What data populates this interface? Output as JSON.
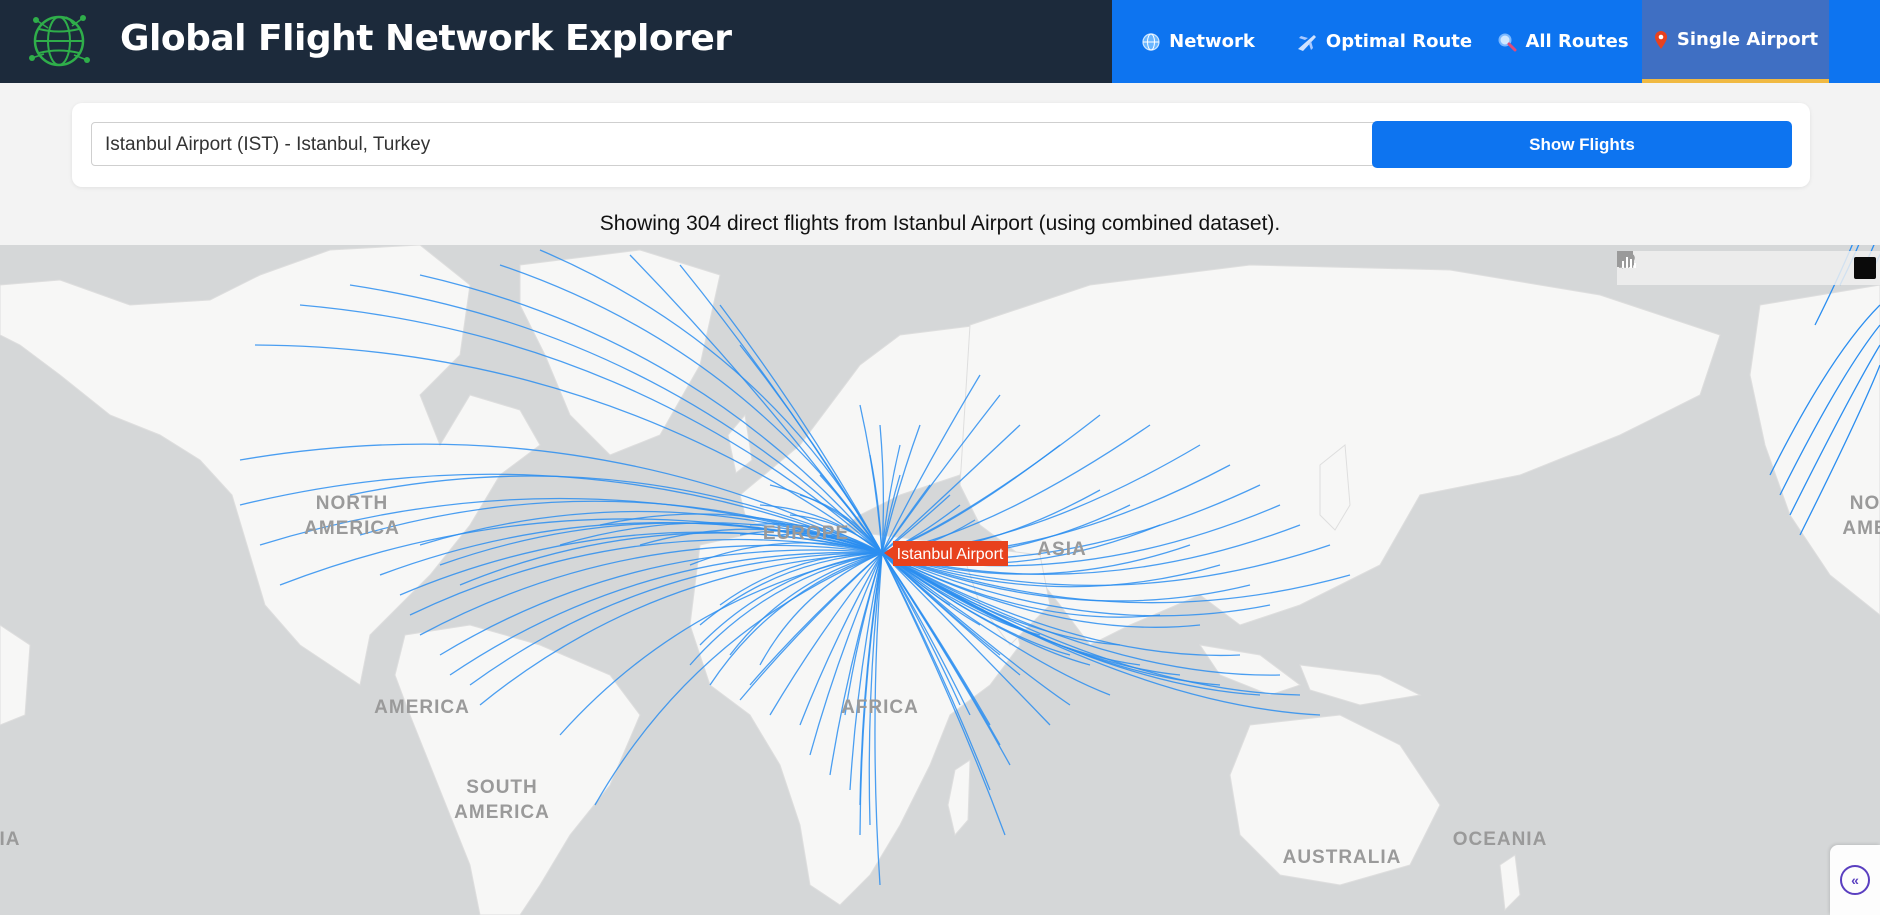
{
  "app": {
    "title": "Global Flight Network Explorer",
    "logo_icon": "globe-network-icon"
  },
  "tabs": [
    {
      "label": "Network",
      "icon": "globe-icon",
      "active": false
    },
    {
      "label": "Optimal Route",
      "icon": "airplane-icon",
      "active": false
    },
    {
      "label": "All Routes",
      "icon": "magnifier-icon",
      "active": false
    },
    {
      "label": "Single Airport",
      "icon": "pin-icon",
      "active": true
    }
  ],
  "controls": {
    "airport_select_value": "Istanbul Airport (IST) - Istanbul, Turkey",
    "clear_symbol": "×",
    "show_button_label": "Show Flights"
  },
  "status_text": "Showing 304 direct flights from Istanbul Airport (using combined dataset).",
  "map": {
    "hub_label": "Istanbul Airport",
    "route_color": "#2b8ef0",
    "hub_label_color": "#e8421e",
    "labels": {
      "north_america": [
        "NORTH",
        "AMERICA"
      ],
      "south_america": [
        "SOUTH",
        "AMERICA"
      ],
      "america": "AMERICA",
      "europe": "EUROPE",
      "asia": "ASIA",
      "africa": "AFRICA",
      "australia": "AUSTRALIA",
      "oceania": "OCEANIA",
      "cut_left": "IA",
      "cut_right": [
        "NO",
        "AME"
      ]
    },
    "modebar_icons": [
      "camera-icon",
      "pan-icon",
      "box-select-icon",
      "lasso-icon",
      "zoom-in-icon",
      "zoom-out-icon",
      "home-icon",
      "plotly-logo-icon"
    ]
  },
  "sidebar_toggle_icon": "collapse-left-icon"
}
